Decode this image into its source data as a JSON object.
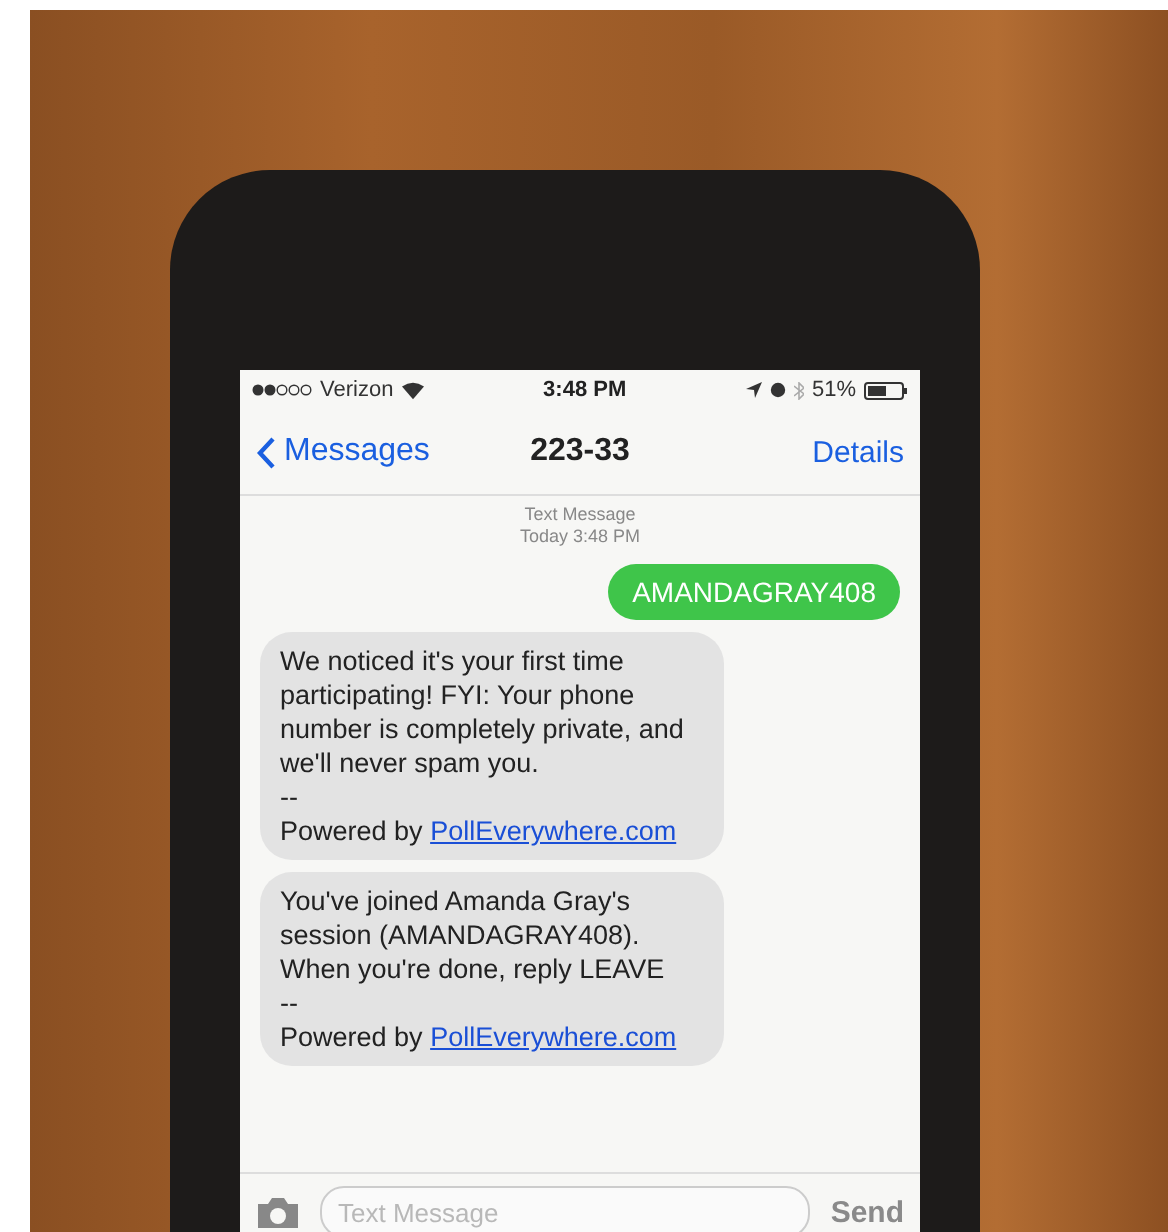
{
  "status_bar": {
    "carrier": "Verizon",
    "time": "3:48 PM",
    "battery": "51%"
  },
  "nav_bar": {
    "back": "Messages",
    "title": "223-33",
    "action": "Details"
  },
  "timestamp": {
    "label": "Text Message",
    "time": "Today 3:48 PM"
  },
  "messages": [
    {
      "kind": "outgoing",
      "text": "AMANDAGRAY408"
    },
    {
      "kind": "incoming",
      "text": "We noticed it's your first time participating! FYI: Your phone number is completely private, and we'll never spam you.",
      "separator": "--",
      "footer": "Powered by",
      "link": "PollEverywhere.com"
    },
    {
      "kind": "incoming",
      "text": "You've joined Amanda Gray's session (AMANDAGRAY408). When you're done, reply LEAVE",
      "separator": "--",
      "footer": "Powered by",
      "link": "PollEverywhere.com"
    }
  ],
  "composer": {
    "placeholder": "Text Message",
    "send": "Send"
  }
}
